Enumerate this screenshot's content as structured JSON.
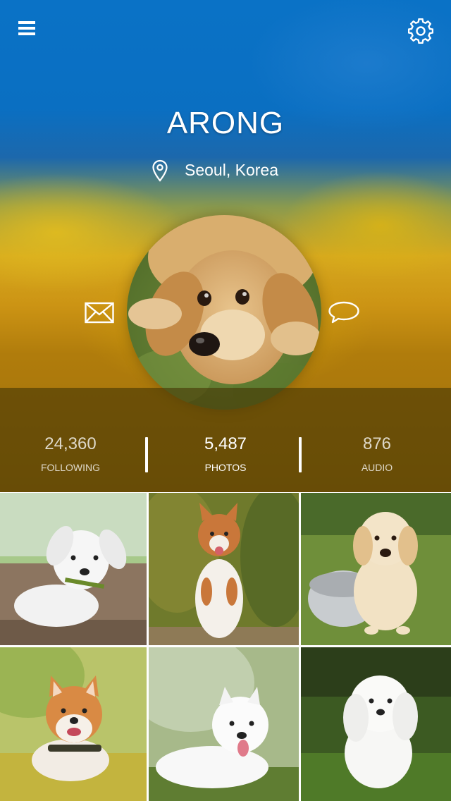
{
  "profile": {
    "name": "ARONG",
    "location": "Seoul, Korea"
  },
  "icons": {
    "menu": "menu-icon",
    "settings": "gear-icon",
    "location": "map-pin-icon",
    "message": "envelope-icon",
    "chat": "chat-bubble-icon"
  },
  "stats": [
    {
      "value": "24,360",
      "label": "FOLLOWING"
    },
    {
      "value": "5,487",
      "label": "PHOTOS"
    },
    {
      "value": "876",
      "label": "AUDIO"
    }
  ],
  "colors": {
    "sky_blue": "#0a72c6",
    "meadow_yellow": "#d6a81e",
    "stats_overlay": "#463705"
  }
}
